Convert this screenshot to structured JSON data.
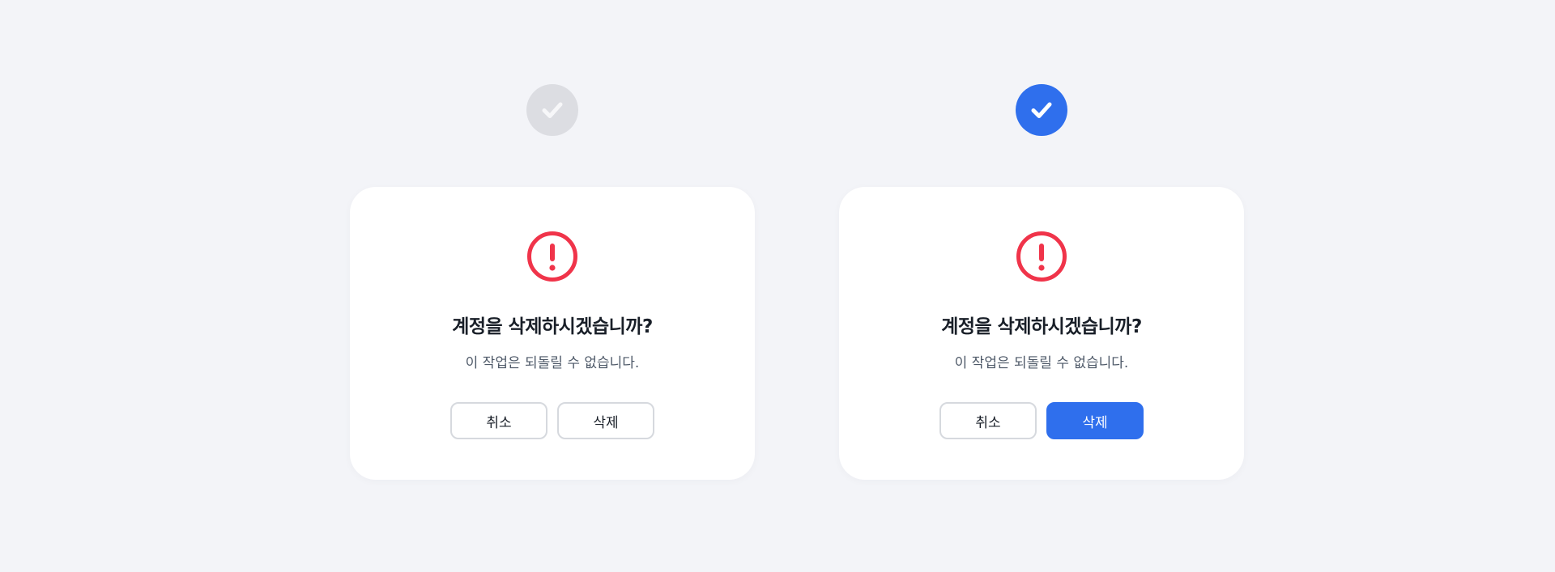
{
  "colors": {
    "background": "#f3f4f8",
    "card": "#ffffff",
    "danger": "#f0344a",
    "primary": "#2f6fed",
    "badge_inactive": "#dcdde2",
    "badge_inactive_check": "#f7f7f9",
    "text_primary": "#191f28",
    "text_secondary": "#4e5968"
  },
  "variants": [
    {
      "state": "default",
      "badge_icon": "check-icon",
      "badge_selected": false,
      "dialog": {
        "icon": "exclamation-circle-icon",
        "title": "계정을 삭제하시겠습니까?",
        "description": "이 작업은 되돌릴 수 없습니다.",
        "cancel_label": "취소",
        "delete_label": "삭제"
      }
    },
    {
      "state": "selected",
      "badge_icon": "check-icon",
      "badge_selected": true,
      "dialog": {
        "icon": "exclamation-circle-icon",
        "title": "계정을 삭제하시겠습니까?",
        "description": "이 작업은 되돌릴 수 없습니다.",
        "cancel_label": "취소",
        "delete_label": "삭제"
      }
    }
  ]
}
